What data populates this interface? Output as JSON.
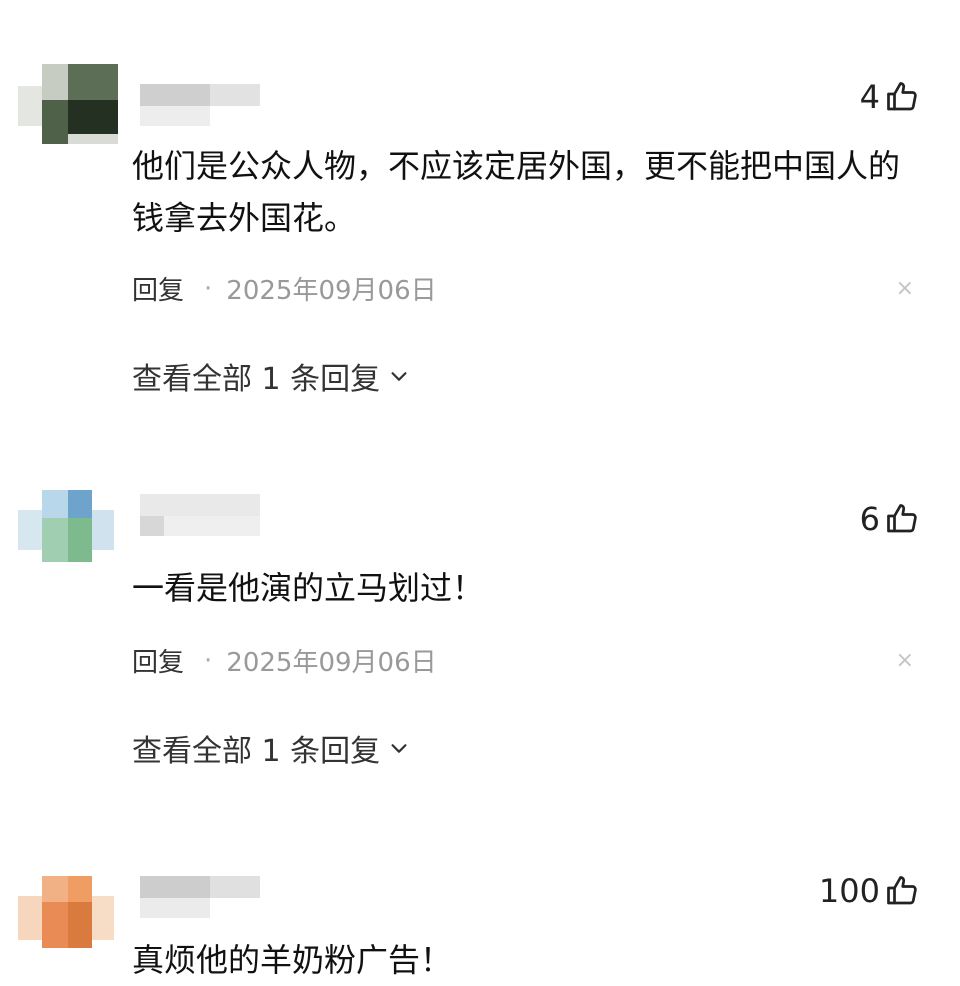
{
  "comments": [
    {
      "likes": "4",
      "text": "他们是公众人物，不应该定居外国，更不能把中国人的钱拿去外国花。",
      "reply_label": "回复",
      "separator": "·",
      "date": "2025年09月06日",
      "close_glyph": "×",
      "view_all_label": "查看全部 1 条回复"
    },
    {
      "likes": "6",
      "text": "一看是他演的立马划过！",
      "reply_label": "回复",
      "separator": "·",
      "date": "2025年09月06日",
      "close_glyph": "×",
      "view_all_label": "查看全部 1 条回复"
    },
    {
      "likes": "100",
      "text": "真烦他的羊奶粉广告！"
    }
  ],
  "icons": {
    "like": "thumbs-up-icon",
    "expand": "chevron-down-icon",
    "close": "close-icon"
  },
  "colors": {
    "avatar1": [
      "#c9cfc5",
      "#2e3b2a",
      "#4d6048",
      "#e7e9e4"
    ],
    "avatar2": [
      "#7fb6d8",
      "#94c9a2",
      "#d5e6ef",
      "#6aa0c8"
    ],
    "avatar3": [
      "#e98a4f",
      "#f2a874",
      "#f7d2b5",
      "#d97a3e"
    ],
    "blur_gray": [
      "#c9c9c9",
      "#dcdcdc",
      "#ececec"
    ]
  }
}
